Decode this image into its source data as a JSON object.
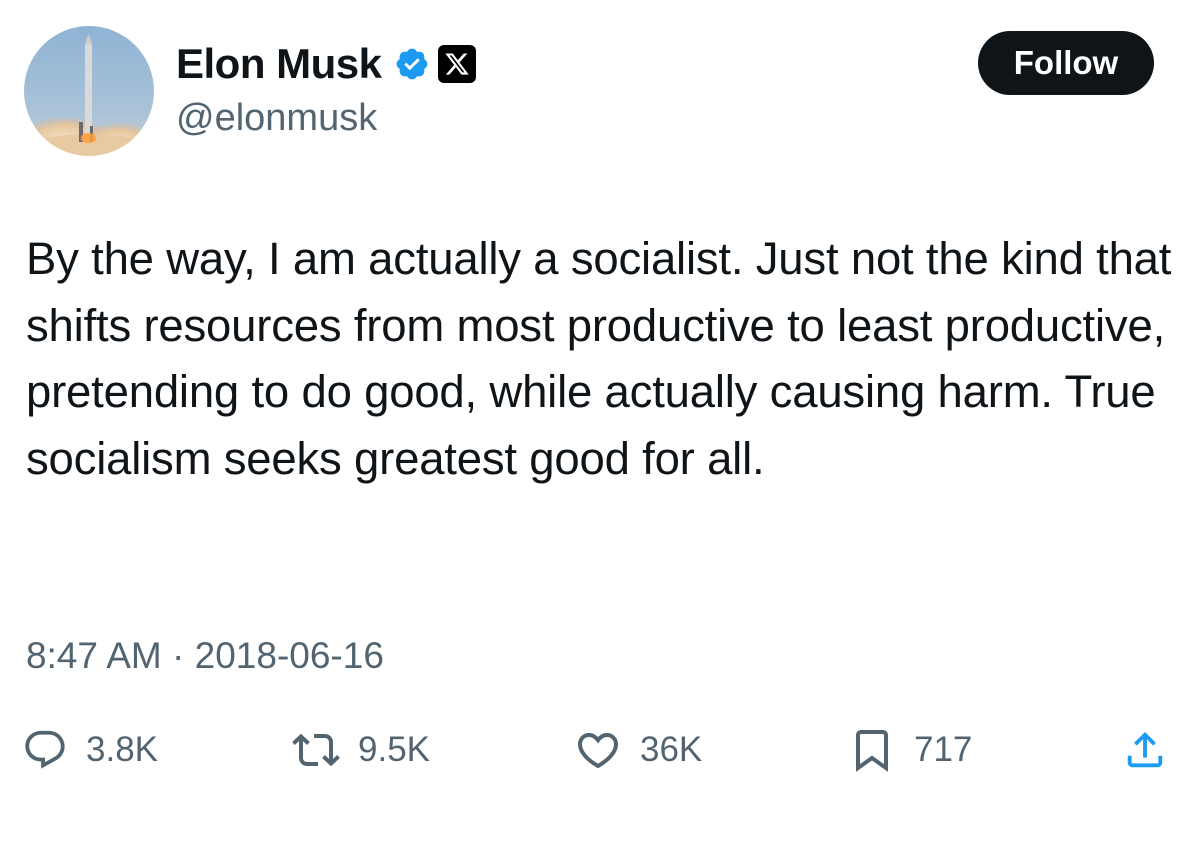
{
  "author": {
    "display_name": "Elon Musk",
    "handle": "@elonmusk",
    "verified": true,
    "affiliation_badge": "x-logo-icon"
  },
  "follow_button": {
    "label": "Follow"
  },
  "tweet": {
    "text": "By the way, I am actually a socialist. Just not the kind that shifts resources from most productive to least productive, pretending to do good, while actually causing harm. True socialism seeks greatest good for all.",
    "timestamp": "8:47 AM · 2018-06-16"
  },
  "actions": {
    "replies": "3.8K",
    "reposts": "9.5K",
    "likes": "36K",
    "bookmarks": "717"
  },
  "colors": {
    "text": "#0f1419",
    "secondary": "#536471",
    "verified_blue": "#1d9bf0",
    "button_bg": "#0f1419"
  },
  "icons": {
    "reply": "reply-icon",
    "repost": "repost-icon",
    "like": "heart-icon",
    "bookmark": "bookmark-icon",
    "share": "share-icon"
  }
}
